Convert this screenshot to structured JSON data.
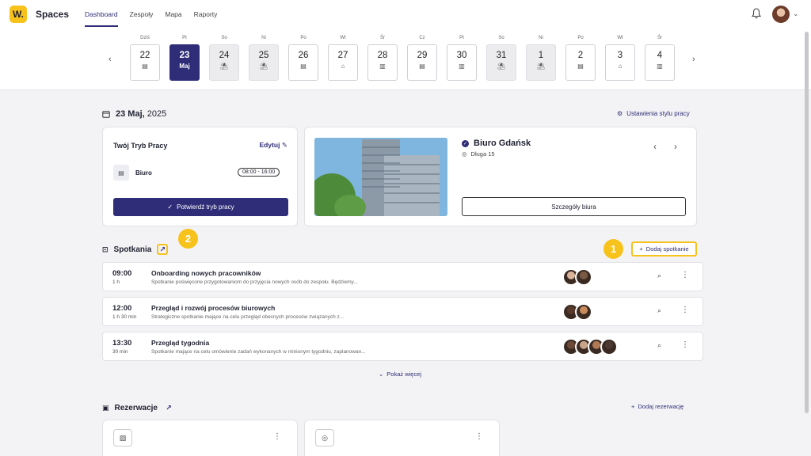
{
  "app": {
    "logo": "W.",
    "name": "Spaces"
  },
  "nav": [
    {
      "label": "Dashboard",
      "active": true
    },
    {
      "label": "Zespoły",
      "active": false
    },
    {
      "label": "Mapa",
      "active": false
    },
    {
      "label": "Raporty",
      "active": false
    }
  ],
  "days": [
    {
      "dow": "Dziś",
      "num": "22",
      "icon": "office-icon",
      "weekend": false
    },
    {
      "dow": "Pt",
      "num": "23",
      "month": "Maj",
      "selected": true,
      "weekend": false
    },
    {
      "dow": "So",
      "num": "24",
      "icon": "beach-icon",
      "weekend": true
    },
    {
      "dow": "Ni",
      "num": "25",
      "icon": "beach-icon",
      "weekend": true
    },
    {
      "dow": "Po",
      "num": "26",
      "icon": "office-icon",
      "weekend": false
    },
    {
      "dow": "Wt",
      "num": "27",
      "icon": "home-icon",
      "weekend": false
    },
    {
      "dow": "Śr",
      "num": "28",
      "icon": "building-icon",
      "weekend": false
    },
    {
      "dow": "Cz",
      "num": "29",
      "icon": "office-icon",
      "weekend": false
    },
    {
      "dow": "Pt",
      "num": "30",
      "icon": "building-icon",
      "weekend": false
    },
    {
      "dow": "So",
      "num": "31",
      "icon": "beach-icon",
      "weekend": true
    },
    {
      "dow": "Ni",
      "num": "1",
      "icon": "beach-icon",
      "weekend": true
    },
    {
      "dow": "Po",
      "num": "2",
      "icon": "office-icon",
      "weekend": false
    },
    {
      "dow": "Wt",
      "num": "3",
      "icon": "home-icon",
      "weekend": false
    },
    {
      "dow": "Śr",
      "num": "4",
      "icon": "building-icon",
      "weekend": false
    }
  ],
  "date": {
    "day_month": "23 Maj,",
    "year": "2025"
  },
  "settings_link": "Ustawienia stylu pracy",
  "work_mode": {
    "title": "Twój Tryb Pracy",
    "edit": "Edytuj",
    "location": "Biuro",
    "hours": "08:00 - 16:00",
    "confirm": "Potwierdź tryb pracy"
  },
  "office": {
    "name": "Biuro Gdańsk",
    "address": "Długa 15",
    "details_button": "Szczegóły biura"
  },
  "meetings": {
    "title": "Spotkania",
    "add": "Dodaj spotkanie",
    "badges": [
      "1",
      "2"
    ],
    "items": [
      {
        "time": "09:00",
        "duration": "1 h",
        "title": "Onboarding nowych pracowników",
        "desc": "Spotkanie poświęcone przygotowaniom do przyjęcia nowych osób do zespołu. Będziemy...",
        "avatars": [
          "#d8b49a",
          "#7a5a45"
        ]
      },
      {
        "time": "12:00",
        "duration": "1 h 30 min",
        "title": "Przegląd i rozwój procesów biurowych",
        "desc": "Strategiczne spotkanie mające na celu przegląd obecnych procesów związanych z...",
        "avatars": [
          "#5a3a2c",
          "#c98b5e"
        ]
      },
      {
        "time": "13:30",
        "duration": "30 min",
        "title": "Przegląd tygodnia",
        "desc": "Spotkanie mające na celu omówienie zadań wykonanych w minionym tygodniu, zaplanowan...",
        "avatars": [
          "#6b4a3a",
          "#c7a48a",
          "#b07a55",
          "#4a3a33"
        ]
      }
    ],
    "show_more": "Pokaż więcej"
  },
  "reservations": {
    "title": "Rezerwacje",
    "add": "Dodaj rezerwację"
  }
}
